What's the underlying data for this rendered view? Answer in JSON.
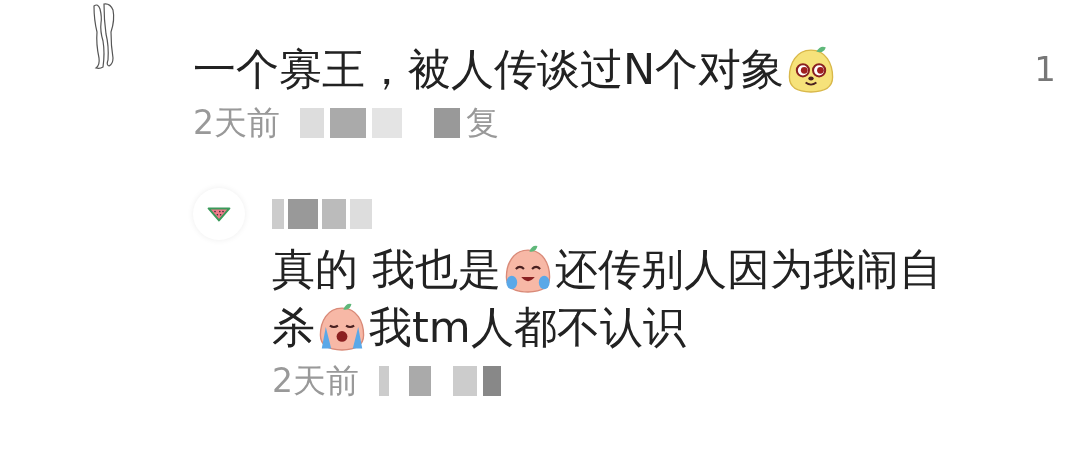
{
  "comments": [
    {
      "avatar": {
        "kind": "sketch"
      },
      "count": "1",
      "body": [
        {
          "kind": "text",
          "text": "一个寡王，被人传谈过N个对象"
        },
        {
          "kind": "smile_emoji"
        }
      ],
      "time": "2天前",
      "reply_tail": "复",
      "replies": [
        {
          "avatar": {
            "kind": "watermelon"
          },
          "body": [
            {
              "kind": "text",
              "text": "真的 我也是"
            },
            {
              "kind": "cry_emoji"
            },
            {
              "kind": "text",
              "text": "还传别人因为我闹自"
            },
            {
              "kind": "text",
              "text": "杀"
            },
            {
              "kind": "sob_emoji"
            },
            {
              "kind": "text",
              "text": "我tm人都不认识"
            }
          ],
          "time": "2天前"
        }
      ]
    }
  ]
}
